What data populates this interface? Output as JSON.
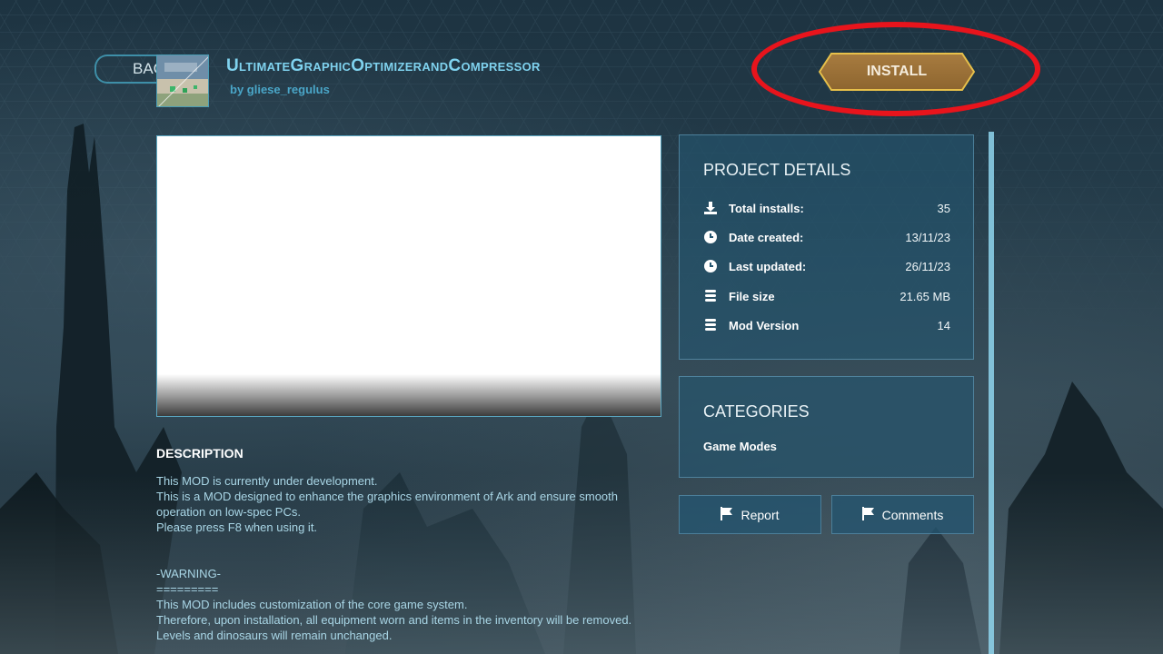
{
  "header": {
    "back_label": "BACK",
    "mod_title": "UltimateGraphicOptimizerandCompressor",
    "author": "by gliese_regulus",
    "install_label": "INSTALL"
  },
  "details": {
    "title": "PROJECT DETAILS",
    "rows": [
      {
        "icon": "download-icon",
        "label": "Total installs:",
        "value": "35"
      },
      {
        "icon": "clock-icon",
        "label": "Date created:",
        "value": "13/11/23"
      },
      {
        "icon": "clock-icon",
        "label": "Last updated:",
        "value": "26/11/23"
      },
      {
        "icon": "database-icon",
        "label": "File size",
        "value": "21.65 MB"
      },
      {
        "icon": "database-icon",
        "label": "Mod Version",
        "value": "14"
      }
    ]
  },
  "categories": {
    "title": "CATEGORIES",
    "items": [
      "Game Modes"
    ]
  },
  "actions": {
    "report_label": "Report",
    "comments_label": "Comments"
  },
  "description": {
    "heading": "DESCRIPTION",
    "lines": [
      "This MOD is currently under development.",
      "This is a MOD designed to enhance the graphics environment of Ark and ensure smooth operation on low-spec PCs.",
      "Please press F8 when using it.",
      "-WARNING-",
      "=========",
      "This MOD includes customization of the core game system.",
      "Therefore, upon installation, all equipment worn and items in the inventory will be removed.",
      "Levels and dinosaurs will remain unchanged."
    ]
  },
  "colors": {
    "accent": "#7fd2ee",
    "install": "#a77b3f",
    "highlight": "#e8141c",
    "panel": "#245570"
  }
}
